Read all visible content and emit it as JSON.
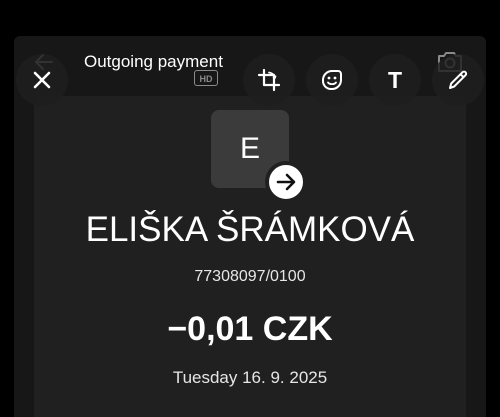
{
  "screenshot": {
    "header": {
      "title": "Outgoing payment",
      "hd_badge": "HD",
      "back_icon": "arrow-left-icon",
      "camera_icon": "camera-icon"
    },
    "card": {
      "avatar_letter": "E",
      "direction_icon": "arrow-right-icon",
      "recipient_name": "ELIŠKA ŠRÁMKOVÁ",
      "account_number": "77308097/0100",
      "amount": "−0,01 CZK",
      "date": "Tuesday 16. 9. 2025"
    }
  },
  "editor_toolbar": {
    "close_icon": "close-icon",
    "crop_icon": "crop-rotate-icon",
    "sticker_icon": "sticker-icon",
    "text_label": "T",
    "pen_icon": "pen-icon"
  },
  "colors": {
    "background": "#000000",
    "screenshot_bg": "#171717",
    "card_bg": "#202020",
    "avatar_bg": "#3b3b3b",
    "text": "#ffffff"
  }
}
